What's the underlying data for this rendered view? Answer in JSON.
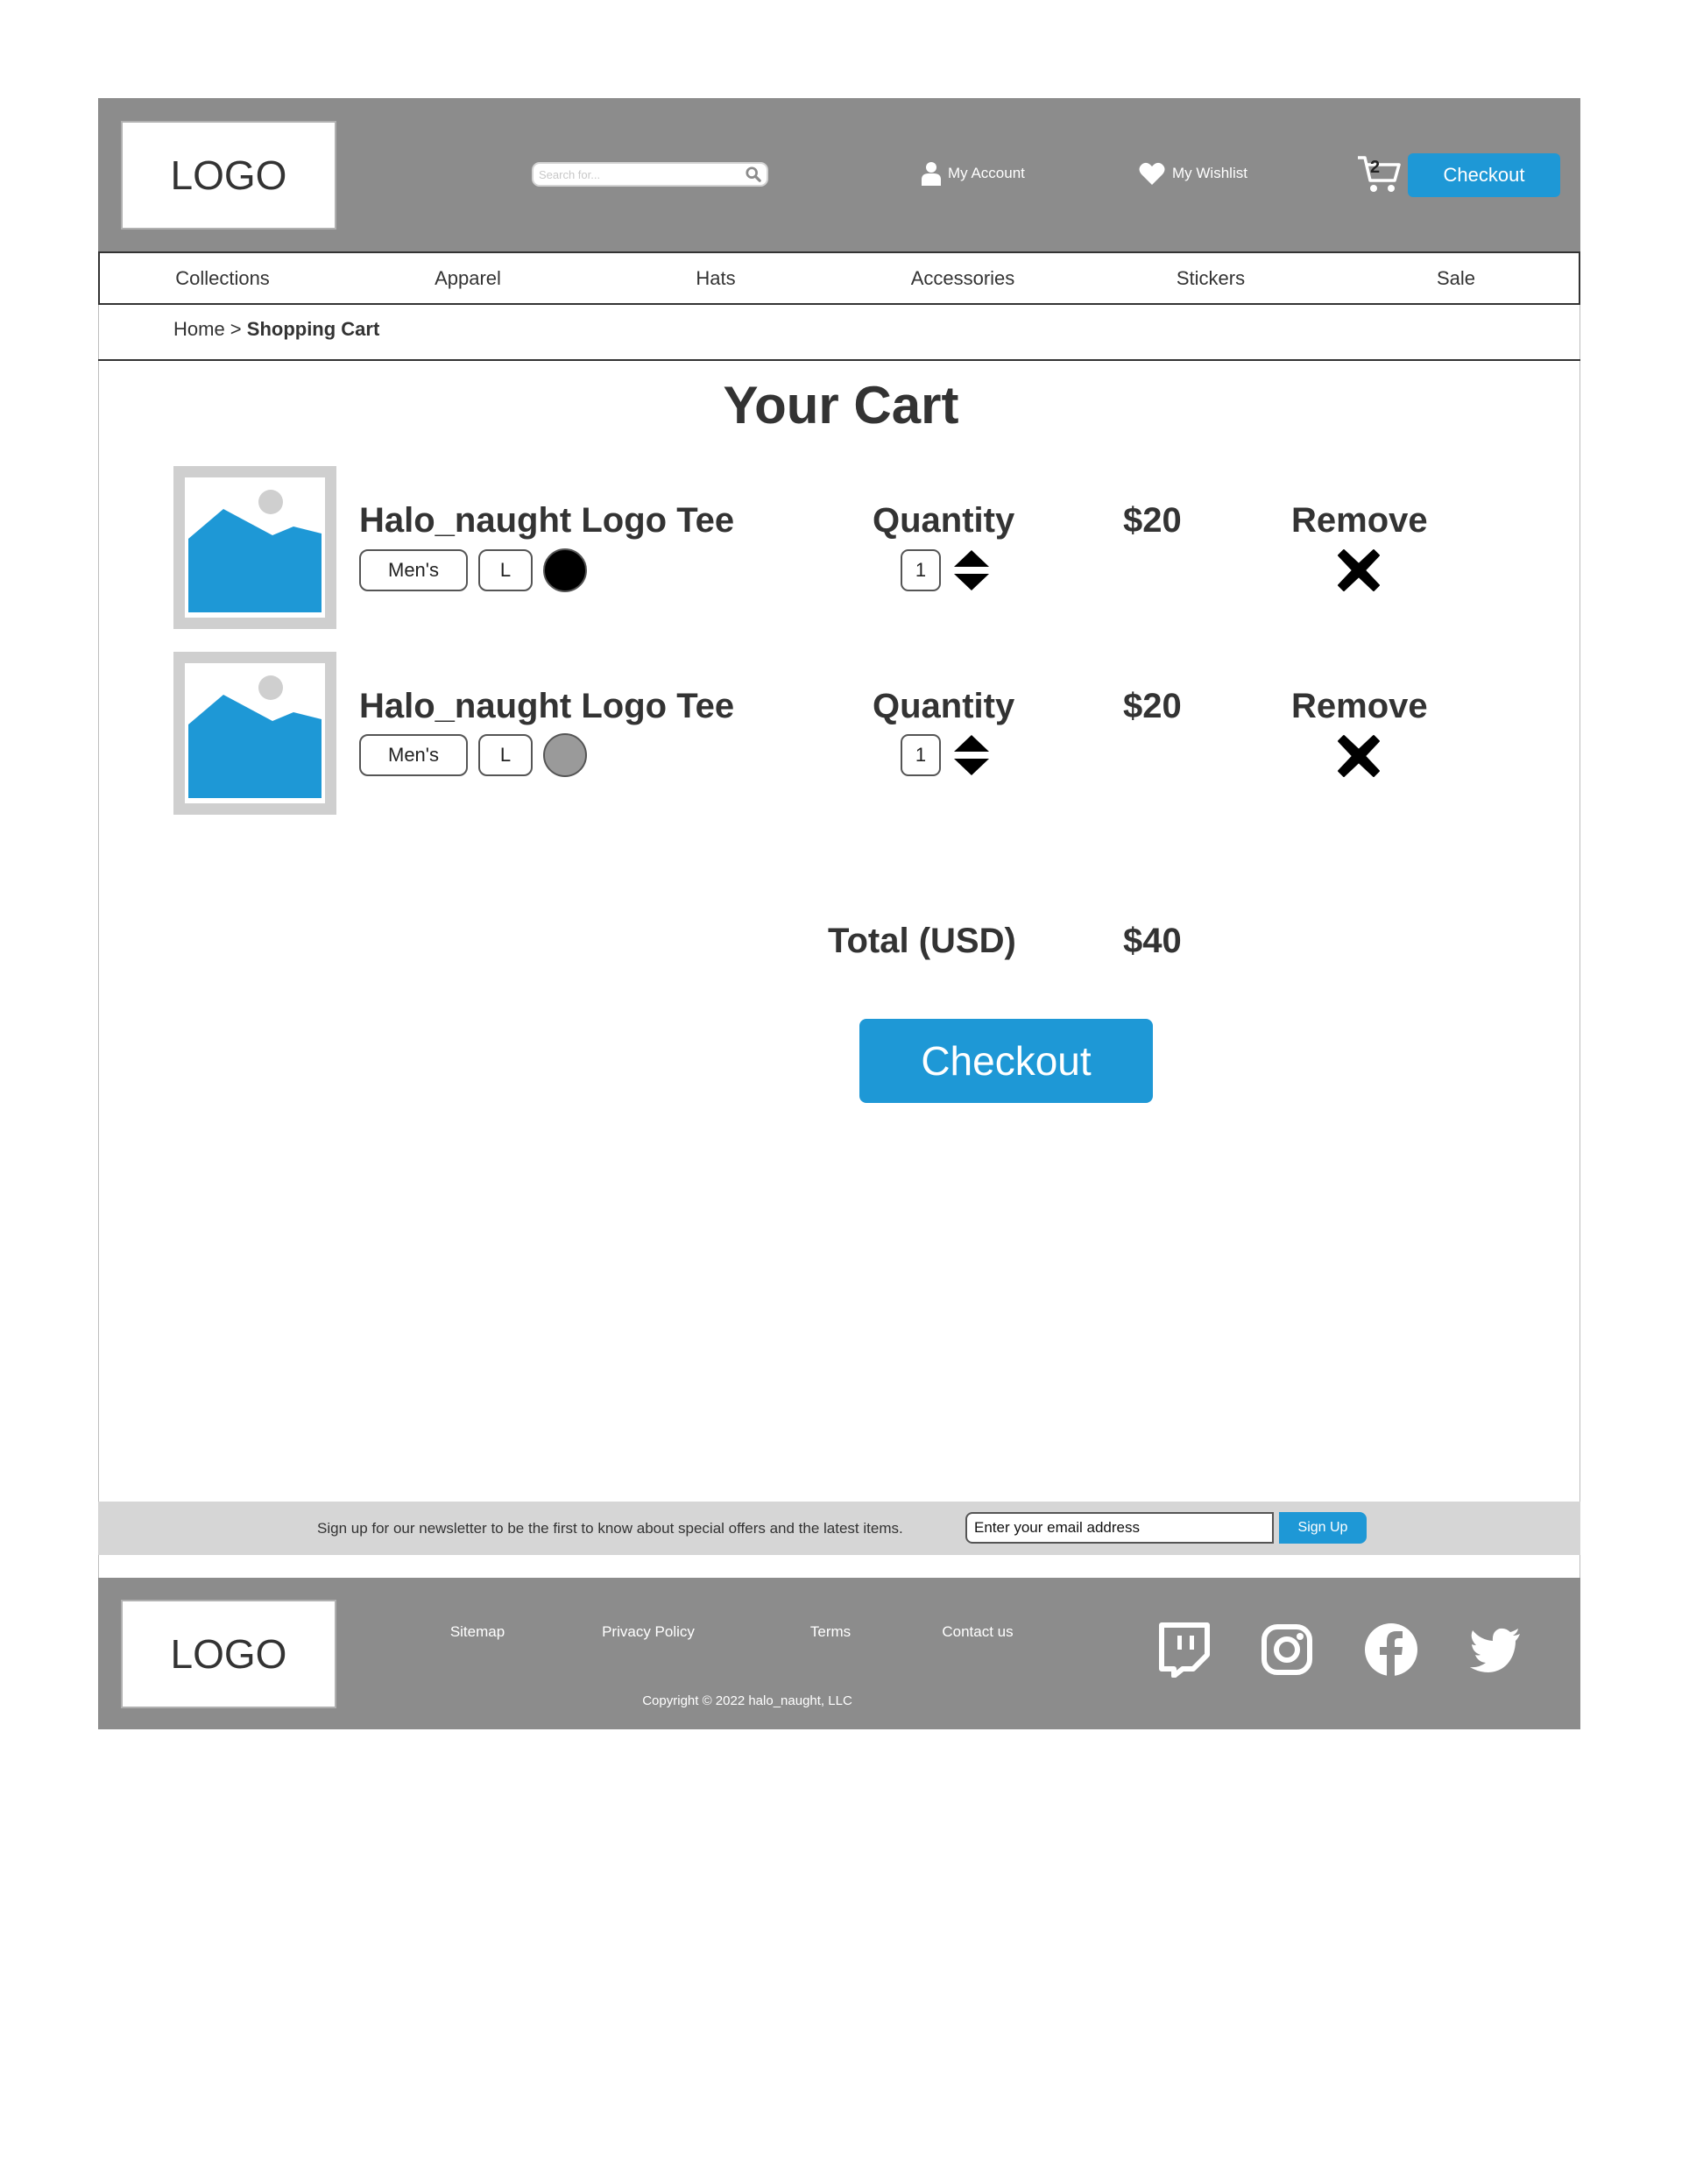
{
  "header": {
    "logo": "LOGO",
    "search_placeholder": "Search for...",
    "account_label": "My Account",
    "wishlist_label": "My Wishlist",
    "cart_count": "2",
    "checkout_label": "Checkout"
  },
  "nav": {
    "items": [
      "Collections",
      "Apparel",
      "Hats",
      "Accessories",
      "Stickers",
      "Sale"
    ]
  },
  "breadcrumb": {
    "home": "Home",
    "separator": " > ",
    "current": "Shopping Cart"
  },
  "page_title": "Your Cart",
  "cart": {
    "quantity_label": "Quantity",
    "remove_label": "Remove",
    "items": [
      {
        "name": "Halo_naught Logo Tee",
        "fit": "Men's",
        "size": "L",
        "color": "#000000",
        "quantity": "1",
        "price": "$20"
      },
      {
        "name": "Halo_naught Logo Tee",
        "fit": "Men's",
        "size": "L",
        "color": "#9a9a9a",
        "quantity": "1",
        "price": "$20"
      }
    ],
    "total_label": "Total (USD)",
    "total_value": "$40",
    "checkout_label": "Checkout"
  },
  "newsletter": {
    "text": "Sign up for our newsletter to be the first to know about special offers and the latest items.",
    "placeholder": "Enter your email address",
    "button_label": "Sign Up"
  },
  "footer": {
    "logo": "LOGO",
    "links": [
      "Sitemap",
      "Privacy Policy",
      "Terms",
      "Contact us"
    ],
    "copyright": "Copyright © 2022 halo_naught, LLC",
    "social_icons": [
      "twitch-icon",
      "instagram-icon",
      "facebook-icon",
      "twitter-icon"
    ]
  },
  "colors": {
    "accent": "#1e98d6",
    "header_bg": "#8c8c8c",
    "newsletter_bg": "#d6d6d6",
    "image_placeholder_blue": "#1e98d6",
    "image_placeholder_gray": "#cfcfcf"
  }
}
